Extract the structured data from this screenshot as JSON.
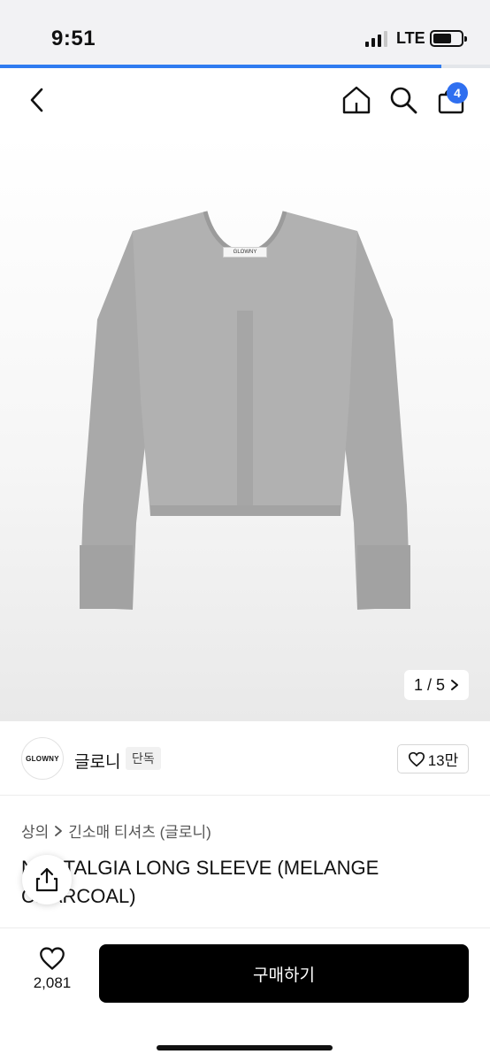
{
  "status_bar": {
    "time": "9:51",
    "network": "LTE",
    "signal_bars": 3,
    "battery_icon": "battery-icon"
  },
  "page_progress": 0.9,
  "nav": {
    "back_icon": "chevron-left-icon",
    "home_icon": "home-icon",
    "search_icon": "search-icon",
    "cart_icon": "shopping-bag-icon",
    "cart_count": "4"
  },
  "product_image": {
    "label_text": "GLOWNY",
    "counter": "1 / 5",
    "next_icon": "chevron-right-icon"
  },
  "brand": {
    "logo_text": "GLOWNY",
    "name": "글로니",
    "tag": "단독",
    "likes": "13만"
  },
  "breadcrumb": {
    "category": "상의",
    "subcategory": "긴소매 티셔츠 (글로니)"
  },
  "product": {
    "title": "NOSTALGIA LONG SLEEVE (MELANGE CHARCOAL)"
  },
  "bottom": {
    "wish_count": "2,081",
    "buy_label": "구매하기"
  },
  "colors": {
    "accent": "#2f7bf0",
    "badge": "#2f6ff0",
    "buy_button": "#000000",
    "garment": "#a9a9a9"
  }
}
